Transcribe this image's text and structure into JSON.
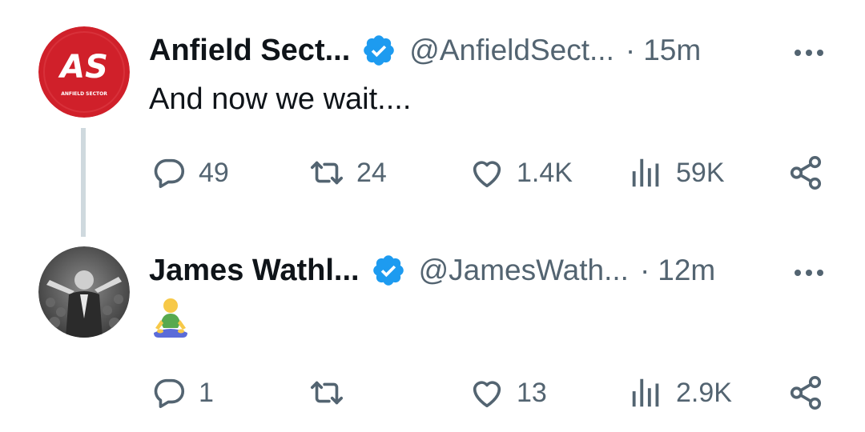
{
  "colors": {
    "verified": "#1d9bf0",
    "text": "#0f1419",
    "secondary": "#536471",
    "thread_line": "#cfd9de",
    "brand_red": "#d0202a"
  },
  "tweets": [
    {
      "avatar": {
        "type": "logo",
        "initials": "AS",
        "caption": "ANFIELD SECTOR"
      },
      "name": "Anfield Sect...",
      "handle": "@AnfieldSect...",
      "separator": "·",
      "time": "15m",
      "text": "And now we wait....",
      "actions": {
        "replies": "49",
        "reposts": "24",
        "likes": "1.4K",
        "views": "59K"
      }
    },
    {
      "avatar": {
        "type": "photo"
      },
      "name": "James Wathl...",
      "handle": "@JamesWath...",
      "separator": "·",
      "time": "12m",
      "emoji": "person-in-lotus-position",
      "actions": {
        "replies": "1",
        "reposts": "",
        "likes": "13",
        "views": "2.9K"
      }
    }
  ]
}
